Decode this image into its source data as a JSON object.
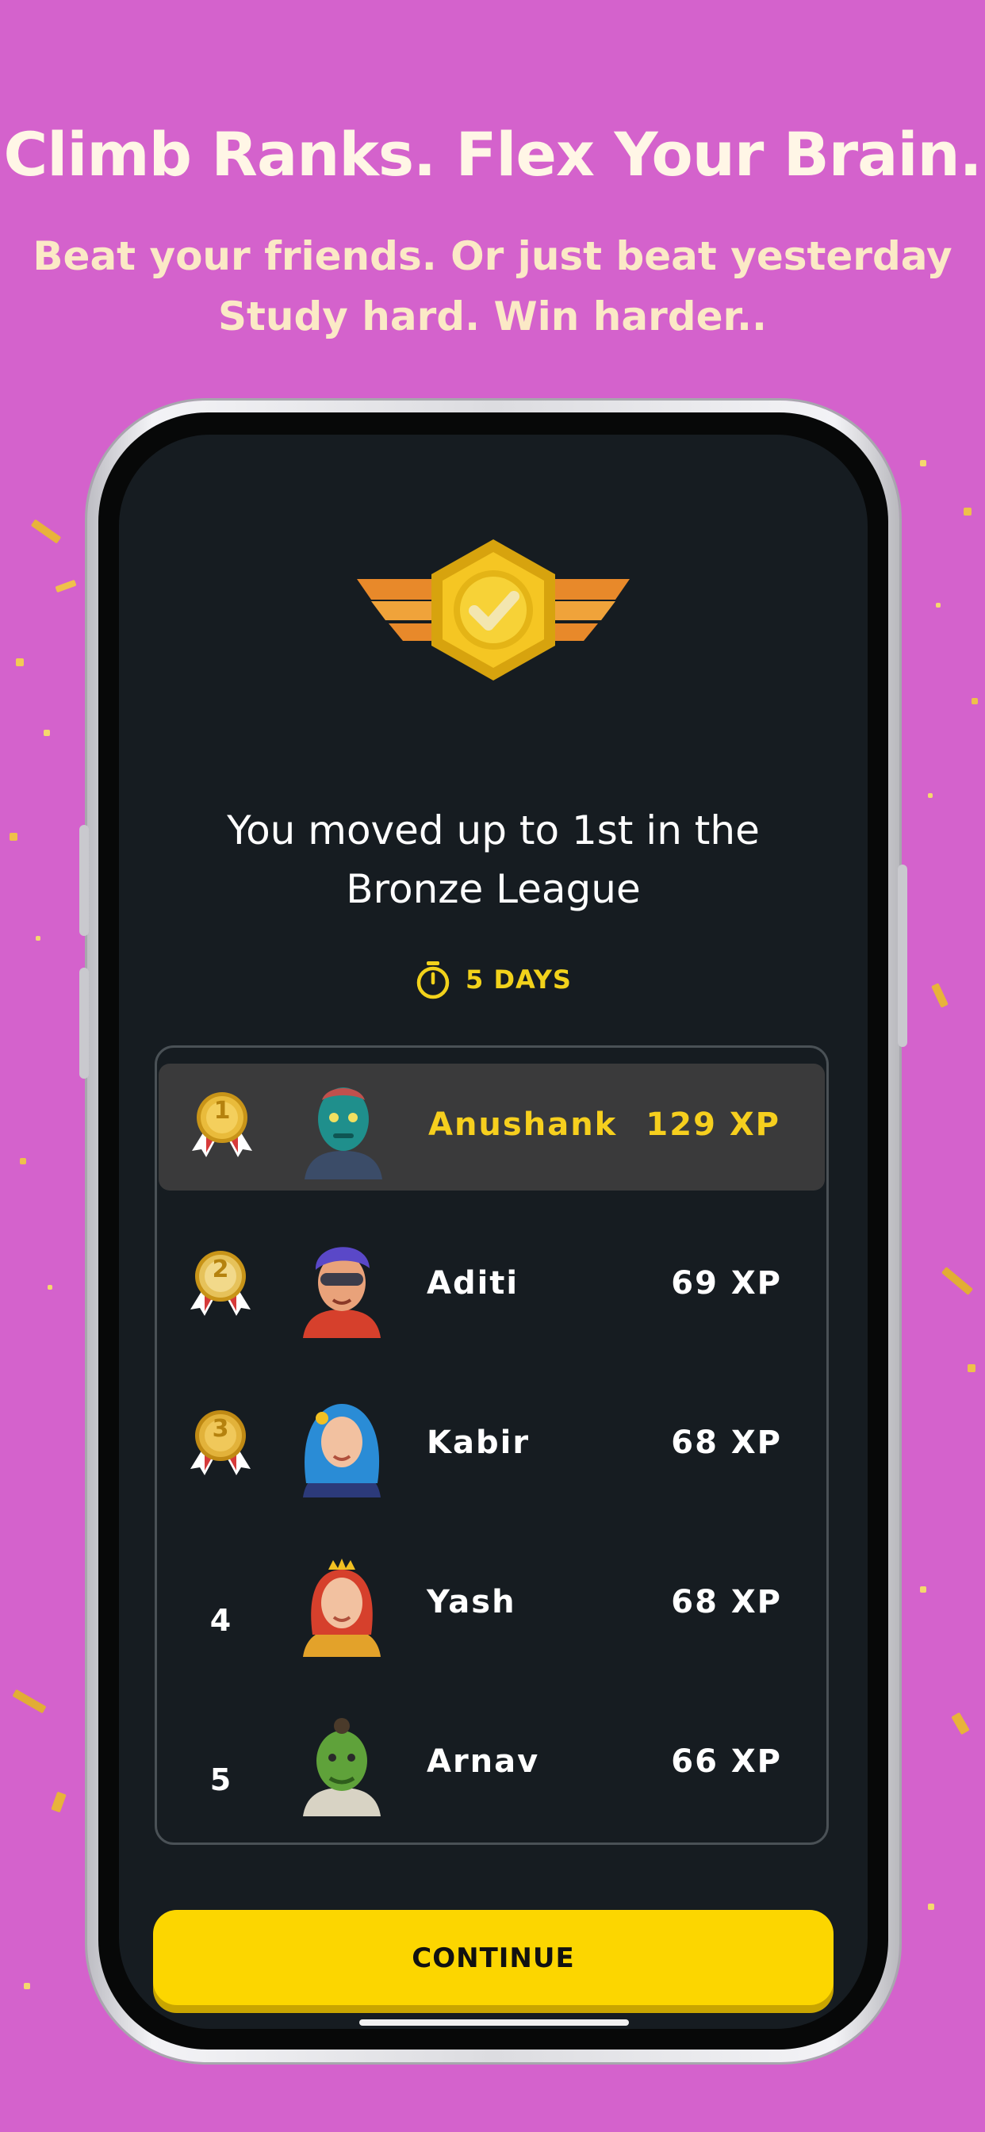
{
  "promo": {
    "headline": "Climb Ranks. Flex Your Brain.",
    "subline_1": "Beat your friends. Or just beat yesterday",
    "subline_2": "Study hard. Win harder.."
  },
  "screen": {
    "title_line_1": "You moved up to 1st in the",
    "title_line_2": "Bronze League",
    "timer_text": "5 DAYS",
    "leaderboard": [
      {
        "rank": "1",
        "medal": "gold-medal-1",
        "name": "Anushank",
        "xp": "129 XP",
        "highlight": true
      },
      {
        "rank": "2",
        "medal": "gold-medal-2",
        "name": "Aditi",
        "xp": "69 XP"
      },
      {
        "rank": "3",
        "medal": "gold-medal-3",
        "name": "Kabir",
        "xp": "68 XP"
      },
      {
        "rank": "4",
        "name": "Yash",
        "xp": "68 XP"
      },
      {
        "rank": "5",
        "name": "Arnav",
        "xp": "66 XP"
      }
    ],
    "continue_label": "CONTINUE"
  },
  "colors": {
    "background": "#d462cc",
    "screen": "#161c21",
    "accent_yellow": "#fcd600",
    "highlight_row": "#3a3a3b"
  }
}
